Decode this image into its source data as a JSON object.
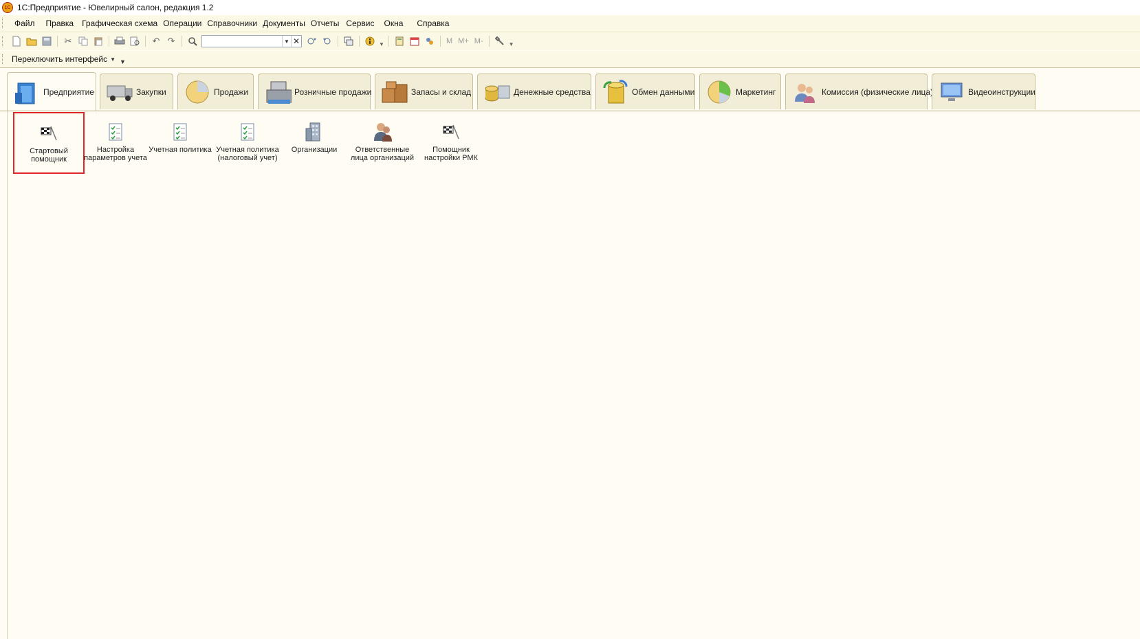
{
  "window": {
    "title": "1С:Предприятие - Ювелирный салон, редакция 1.2",
    "logo_text": "1С"
  },
  "menu": [
    "Файл",
    "Правка",
    "Графическая схема",
    "Операции",
    "Справочники",
    "Документы",
    "Отчеты",
    "Сервис",
    "Окна",
    "Справка"
  ],
  "toolbar": {
    "search_value": "",
    "m_buttons": [
      "M",
      "M+",
      "M-"
    ]
  },
  "interface_switch": {
    "label": "Переключить интерфейс"
  },
  "tabs": [
    {
      "label": "Предприятие",
      "icon": "enterprise-icon"
    },
    {
      "label": "Закупки",
      "icon": "truck-icon"
    },
    {
      "label": "Продажи",
      "icon": "pie-icon"
    },
    {
      "label": "Розничные продажи",
      "icon": "cash-register-icon"
    },
    {
      "label": "Запасы и склад",
      "icon": "boxes-icon"
    },
    {
      "label": "Денежные средства",
      "icon": "coins-icon"
    },
    {
      "label": "Обмен данными",
      "icon": "database-sync-icon"
    },
    {
      "label": "Маркетинг",
      "icon": "marketing-pie-icon"
    },
    {
      "label": "Комиссия (физические лица)",
      "icon": "people-icon"
    },
    {
      "label": "Видеоинструкции",
      "icon": "monitor-icon"
    }
  ],
  "items": [
    {
      "label": "Стартовый помощник",
      "icon": "checkered-flag-icon"
    },
    {
      "label": "Настройка параметров учета",
      "icon": "checklist-icon"
    },
    {
      "label": "Учетная политика",
      "icon": "checklist-icon"
    },
    {
      "label": "Учетная политика (налоговый учет)",
      "icon": "checklist-icon"
    },
    {
      "label": "Организации",
      "icon": "building-icon"
    },
    {
      "label": "Ответственные лица организаций",
      "icon": "person-icon"
    },
    {
      "label": "Помощник настройки РМК",
      "icon": "checkered-flag-icon"
    }
  ],
  "colors": {
    "selection_outline": "#e0262b",
    "background": "#fffdf3",
    "toolbar": "#fbf8e6"
  }
}
